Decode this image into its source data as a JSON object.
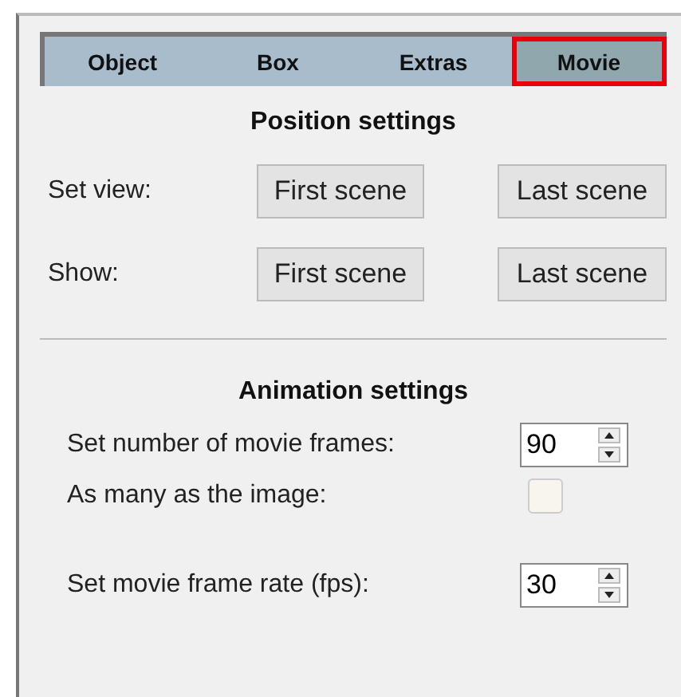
{
  "tabs": [
    {
      "label": "Object",
      "selected": false,
      "highlighted": false
    },
    {
      "label": "Box",
      "selected": false,
      "highlighted": false
    },
    {
      "label": "Extras",
      "selected": false,
      "highlighted": false
    },
    {
      "label": "Movie",
      "selected": true,
      "highlighted": true
    }
  ],
  "position_settings": {
    "title": "Position settings",
    "rows": [
      {
        "label": "Set view:",
        "buttons": [
          "First scene",
          "Last scene"
        ]
      },
      {
        "label": "Show:",
        "buttons": [
          "First scene",
          "Last scene"
        ]
      }
    ]
  },
  "animation_settings": {
    "title": "Animation settings",
    "rows": [
      {
        "kind": "spinner",
        "label": "Set number of movie frames:",
        "value": "90"
      },
      {
        "kind": "checkbox",
        "label": "As many as the image:",
        "checked": false
      },
      {
        "kind": "spinner",
        "label": "Set movie frame rate (fps):",
        "value": "30"
      }
    ]
  }
}
